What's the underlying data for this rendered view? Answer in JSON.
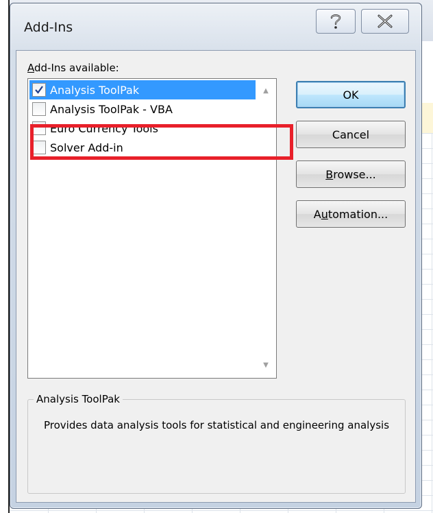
{
  "dialog": {
    "title": "Add-Ins",
    "help_symbol": "?",
    "close_symbol": "X"
  },
  "list": {
    "label_prefix": "",
    "label_access": "A",
    "label_rest": "dd-Ins available:",
    "items": [
      {
        "label": "Analysis ToolPak",
        "checked": true,
        "selected": true
      },
      {
        "label": "Analysis ToolPak - VBA",
        "checked": false,
        "selected": false
      },
      {
        "label": "Euro Currency Tools",
        "checked": false,
        "selected": false
      },
      {
        "label": "Solver Add-in",
        "checked": false,
        "selected": false
      }
    ]
  },
  "buttons": {
    "ok": {
      "pre": "",
      "access": "",
      "post": "OK"
    },
    "cancel": {
      "pre": "",
      "access": "",
      "post": "Cancel"
    },
    "browse": {
      "pre": "",
      "access": "B",
      "post": "rowse..."
    },
    "automation": {
      "pre": "A",
      "access": "u",
      "post": "tomation..."
    }
  },
  "description": {
    "title": "Analysis ToolPak",
    "text": "Provides data analysis tools for statistical and engineering analysis"
  },
  "colors": {
    "selection": "#3399ff",
    "highlight": "#e8202a"
  }
}
